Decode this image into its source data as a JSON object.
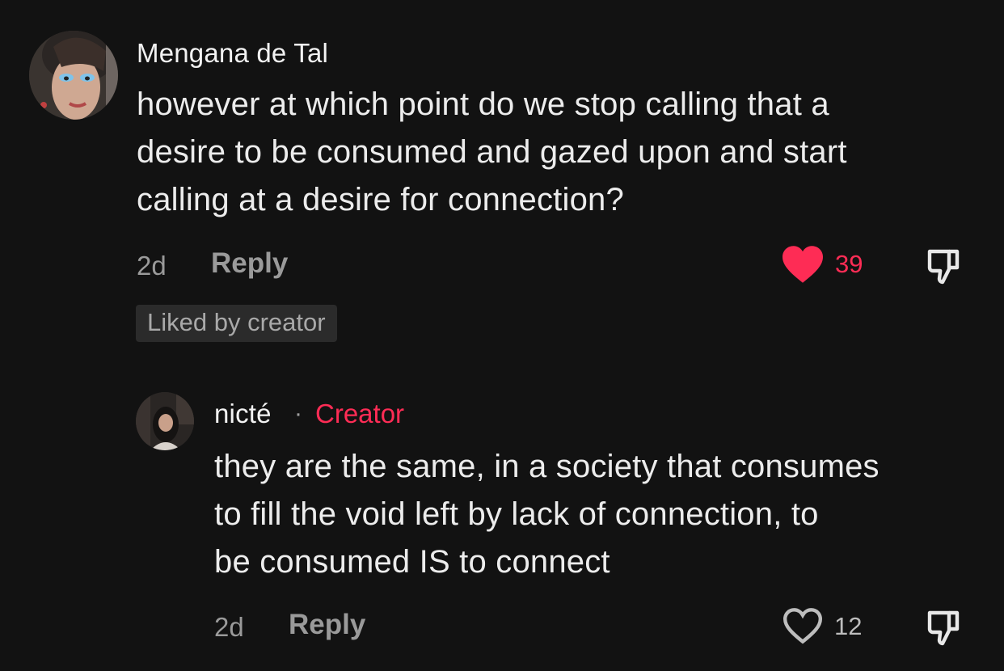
{
  "colors": {
    "background": "#121212",
    "accent": "#fe2c55",
    "muted": "#9a9a9a"
  },
  "comments": [
    {
      "author": "Mengana de Tal",
      "text_lines": [
        "however at which point do we stop calling that a",
        "desire to be consumed and gazed upon and start",
        "calling at a desire for connection?"
      ],
      "time": "2d",
      "reply_label": "Reply",
      "like_count": "39",
      "liked": true,
      "liked_by_creator_label": "Liked by creator",
      "icons": {
        "like": "heart-filled-icon",
        "dislike": "thumbs-down-icon"
      }
    },
    {
      "author": "nicté",
      "separator": "·",
      "creator_label": "Creator",
      "text_lines": [
        "they are the same, in a society that consumes",
        "to fill the void left by lack of connection, to",
        "be consumed IS to connect"
      ],
      "time": "2d",
      "reply_label": "Reply",
      "like_count": "12",
      "liked": false,
      "icons": {
        "like": "heart-outline-icon",
        "dislike": "thumbs-down-icon"
      }
    }
  ]
}
